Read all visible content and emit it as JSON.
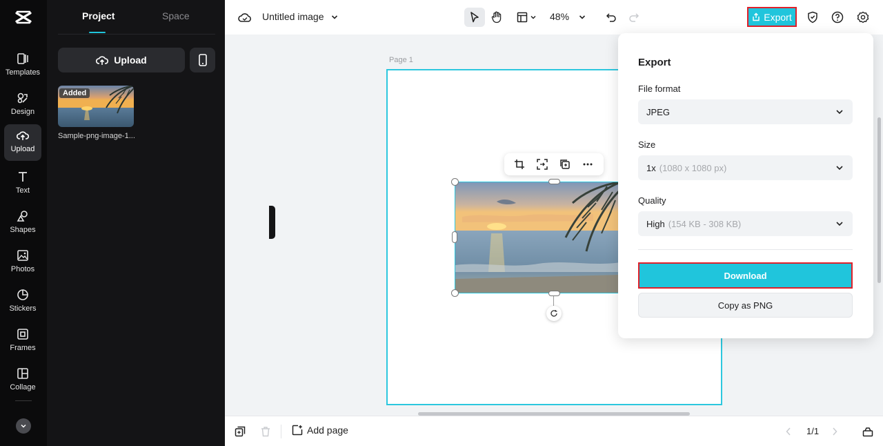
{
  "sidebar": {
    "items": [
      {
        "label": "Templates",
        "icon": "templates-icon"
      },
      {
        "label": "Design",
        "icon": "design-icon"
      },
      {
        "label": "Upload",
        "icon": "upload-cloud-icon",
        "active": true
      },
      {
        "label": "Text",
        "icon": "text-icon"
      },
      {
        "label": "Shapes",
        "icon": "shapes-icon"
      },
      {
        "label": "Photos",
        "icon": "photos-icon"
      },
      {
        "label": "Stickers",
        "icon": "stickers-icon"
      },
      {
        "label": "Frames",
        "icon": "frames-icon"
      },
      {
        "label": "Collage",
        "icon": "collage-icon"
      }
    ]
  },
  "panel": {
    "tabs": [
      {
        "label": "Project",
        "active": true
      },
      {
        "label": "Space"
      }
    ],
    "upload_label": "Upload",
    "asset": {
      "badge": "Added",
      "name": "Sample-png-image-1..."
    }
  },
  "header": {
    "title": "Untitled image",
    "zoom": "48%",
    "export_label": "Export"
  },
  "canvas": {
    "page_label": "Page 1"
  },
  "footer": {
    "add_page_label": "Add page",
    "page_count": "1/1"
  },
  "export_panel": {
    "title": "Export",
    "file_format": {
      "label": "File format",
      "value": "JPEG"
    },
    "size": {
      "label": "Size",
      "value": "1x",
      "detail": "(1080 x 1080 px)"
    },
    "quality": {
      "label": "Quality",
      "value": "High",
      "detail": "(154 KB - 308 KB)"
    },
    "download_label": "Download",
    "copy_label": "Copy as PNG"
  },
  "colors": {
    "accent": "#20c5dc",
    "highlight": "#e0202a",
    "rail_bg": "#0b0b0c",
    "panel_bg": "#141416"
  }
}
